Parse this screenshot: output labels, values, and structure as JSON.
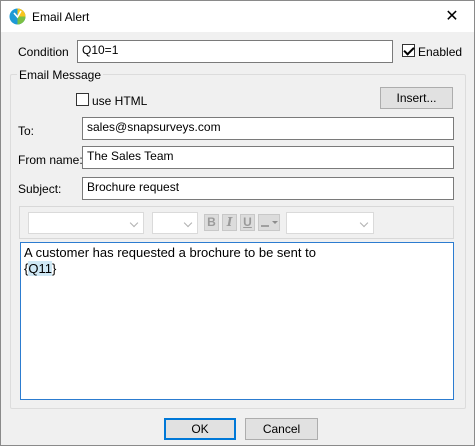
{
  "window": {
    "title": "Email Alert",
    "close_glyph": "✕"
  },
  "condition": {
    "label": "Condition",
    "value": "Q10=1",
    "enabled_label": "Enabled",
    "enabled": true
  },
  "email_message": {
    "group_label": "Email Message",
    "use_html_label": "use HTML",
    "use_html": false,
    "insert_label": "Insert...",
    "to_label": "To:",
    "to_value": "sales@snapsurveys.com",
    "from_label": "From name:",
    "from_value": "The Sales Team",
    "subject_label": "Subject:",
    "subject_value": "Brochure request",
    "body_line1": "A customer has requested a brochure to be sent to",
    "body_open_brace": "{",
    "body_token": "Q11",
    "body_close_brace": "}"
  },
  "toolbar": {
    "bold": "B",
    "italic": "I",
    "underline": "U"
  },
  "buttons": {
    "ok": "OK",
    "cancel": "Cancel"
  },
  "colors": {
    "accent": "#0078d7",
    "editor_border": "#2c7cd0",
    "token_highlight": "#cfe8f5"
  },
  "icons": [
    "app-logo-icon",
    "close-icon",
    "checkmark-icon",
    "chevron-down-icon",
    "line-style-icon"
  ]
}
